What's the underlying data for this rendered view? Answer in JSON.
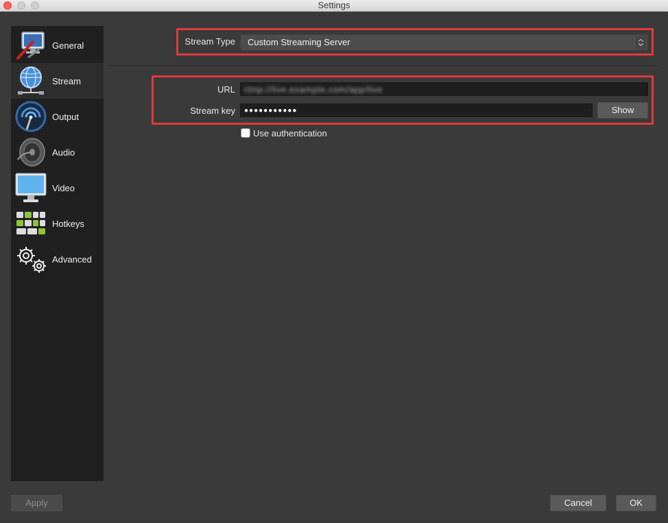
{
  "window": {
    "title": "Settings"
  },
  "sidebar": {
    "items": [
      {
        "label": "General",
        "icon": "general-icon"
      },
      {
        "label": "Stream",
        "icon": "globe-network-icon",
        "active": true
      },
      {
        "label": "Output",
        "icon": "output-broadcast-icon"
      },
      {
        "label": "Audio",
        "icon": "speaker-icon"
      },
      {
        "label": "Video",
        "icon": "monitor-icon"
      },
      {
        "label": "Hotkeys",
        "icon": "keyboard-icon"
      },
      {
        "label": "Advanced",
        "icon": "gears-icon"
      }
    ]
  },
  "stream": {
    "type_label": "Stream Type",
    "type_value": "Custom Streaming Server",
    "url_label": "URL",
    "url_value": "rtmp://live.example.com/app/live",
    "key_label": "Stream key",
    "key_value": "●●●●●●●●●●●",
    "show_label": "Show",
    "auth_label": "Use authentication",
    "auth_checked": false
  },
  "footer": {
    "apply_label": "Apply",
    "cancel_label": "Cancel",
    "ok_label": "OK"
  },
  "colors": {
    "highlight": "#e03a3a",
    "background": "#3a3a3a",
    "sidebar": "#202020"
  }
}
